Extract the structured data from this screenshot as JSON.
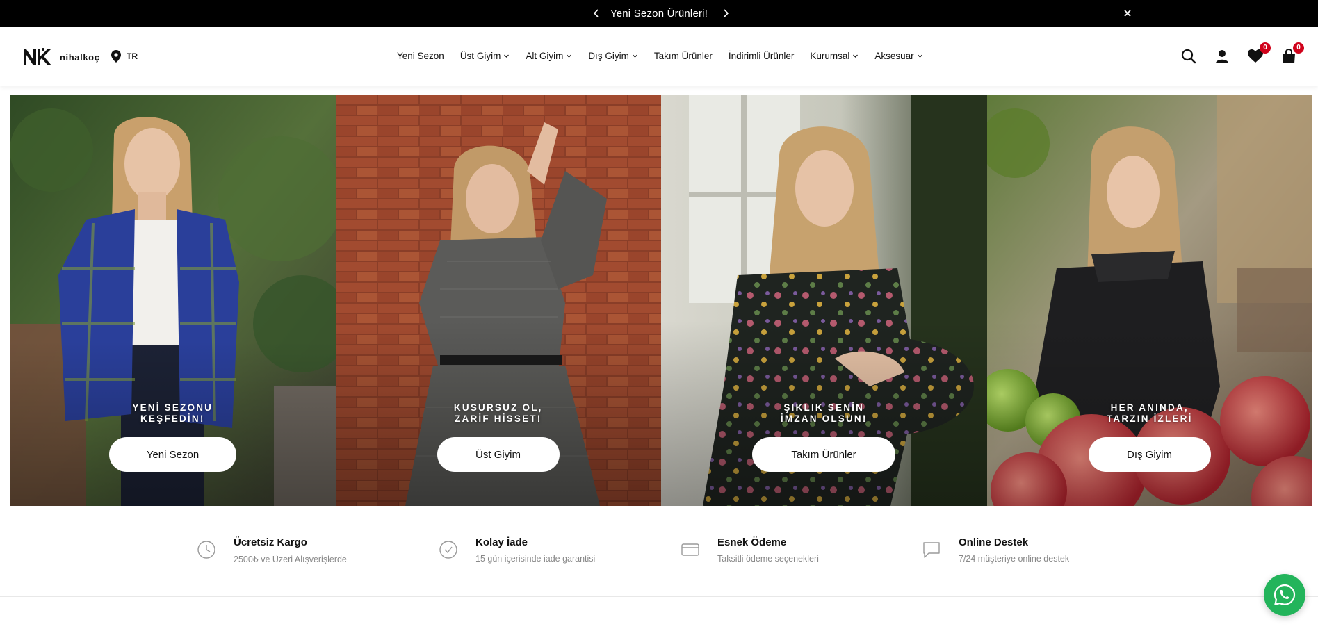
{
  "announcement": {
    "text": "Yeni Sezon Ürünleri!",
    "prev_icon": "chevron-left-icon",
    "next_icon": "chevron-right-icon",
    "close_icon": "close-icon",
    "background": "#000000"
  },
  "header": {
    "logo": {
      "mark": "NK",
      "wordmark": "nihalkoç"
    },
    "language": {
      "code": "TR",
      "icon": "location-pin-icon"
    },
    "nav": [
      {
        "label": "Yeni Sezon",
        "dropdown": false
      },
      {
        "label": "Üst Giyim",
        "dropdown": true
      },
      {
        "label": "Alt Giyim",
        "dropdown": true
      },
      {
        "label": "Dış Giyim",
        "dropdown": true
      },
      {
        "label": "Takım Ürünler",
        "dropdown": false
      },
      {
        "label": "İndirimli Ürünler",
        "dropdown": false
      },
      {
        "label": "Kurumsal",
        "dropdown": true
      },
      {
        "label": "Aksesuar",
        "dropdown": true
      }
    ],
    "icons": {
      "search": "search-icon",
      "account": "user-icon",
      "wishlist": {
        "icon": "heart-icon",
        "count": "0"
      },
      "cart": {
        "icon": "shopping-bag-icon",
        "count": "0"
      }
    },
    "badge_color": "#d0021b"
  },
  "hero": {
    "panels": [
      {
        "caption_line1": "YENİ SEZONU",
        "caption_line2": "KEŞFEDİN!",
        "button": "Yeni Sezon"
      },
      {
        "caption_line1": "KUSURSUZ OL,",
        "caption_line2": "ZARİF HİSSET!",
        "button": "Üst Giyim"
      },
      {
        "caption_line1": "ŞIKLIK SENİN",
        "caption_line2": "İMZAN OLSUN!",
        "button": "Takım Ürünler"
      },
      {
        "caption_line1": "HER ANINDA,",
        "caption_line2": "TARZIN İZLERİ",
        "button": "Dış Giyim"
      }
    ]
  },
  "features": [
    {
      "icon": "clock-icon",
      "title": "Ücretsiz Kargo",
      "subtitle": "2500₺ ve Üzeri Alışverişlerde"
    },
    {
      "icon": "check-circle-icon",
      "title": "Kolay İade",
      "subtitle": "15 gün içerisinde iade garantisi"
    },
    {
      "icon": "credit-card-icon",
      "title": "Esnek Ödeme",
      "subtitle": "Taksitli ödeme seçenekleri"
    },
    {
      "icon": "chat-bubble-icon",
      "title": "Online Destek",
      "subtitle": "7/24 müşteriye online destek"
    }
  ],
  "whatsapp": {
    "icon": "whatsapp-icon",
    "color": "#23b45b"
  }
}
